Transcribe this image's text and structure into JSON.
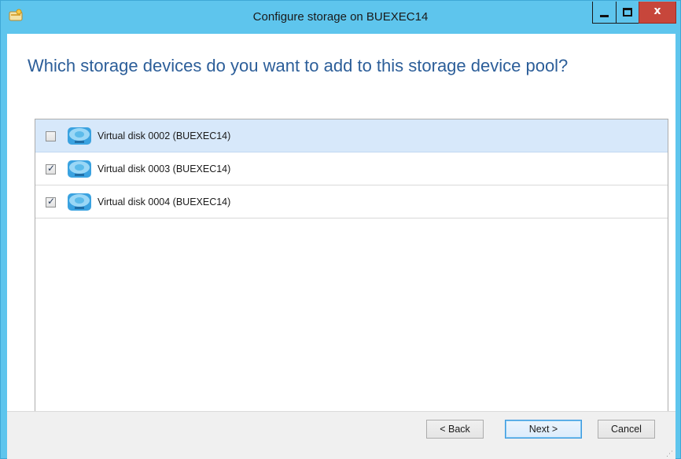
{
  "window": {
    "title": "Configure storage on BUEXEC14",
    "close_symbol": "x"
  },
  "wizard": {
    "heading": "Which storage devices do you want to add to this storage device pool?"
  },
  "devices": [
    {
      "label": "Virtual disk 0002 (BUEXEC14)",
      "checked": false,
      "selected": true,
      "icon": "virtual-disk-icon"
    },
    {
      "label": "Virtual disk 0003 (BUEXEC14)",
      "checked": true,
      "selected": false,
      "icon": "virtual-disk-icon"
    },
    {
      "label": "Virtual disk 0004 (BUEXEC14)",
      "checked": true,
      "selected": false,
      "icon": "virtual-disk-icon"
    }
  ],
  "buttons": {
    "back": "< Back",
    "next": "Next >",
    "cancel": "Cancel"
  },
  "colors": {
    "titlebar": "#5ec5ed",
    "heading": "#2c5e99",
    "selected_row": "#d7e8fa",
    "close_button": "#c7463b"
  }
}
